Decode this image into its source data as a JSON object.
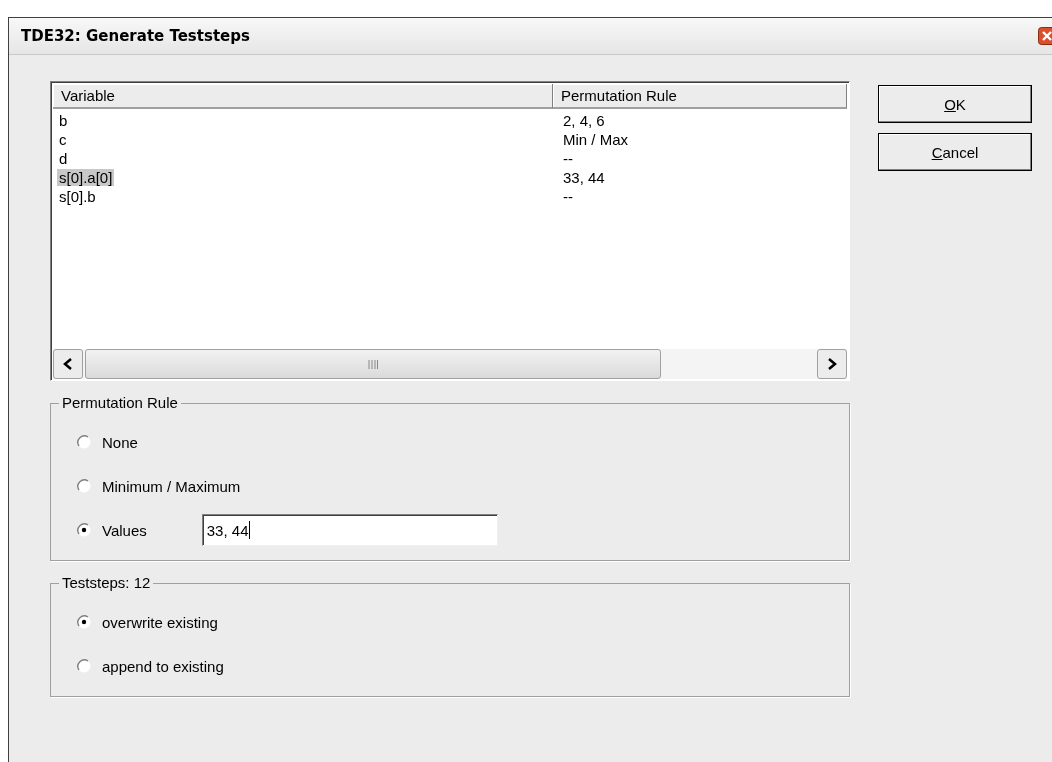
{
  "window": {
    "title": "TDE32: Generate Teststeps"
  },
  "table": {
    "columns": [
      "Variable",
      "Permutation Rule"
    ],
    "rows": [
      {
        "cells": [
          "b",
          "2, 4, 6"
        ],
        "selected": false
      },
      {
        "cells": [
          "c",
          "Min / Max"
        ],
        "selected": false
      },
      {
        "cells": [
          "d",
          "--"
        ],
        "selected": false
      },
      {
        "cells": [
          "s[0].a[0]",
          "33, 44"
        ],
        "selected": true
      },
      {
        "cells": [
          "s[0].b",
          "--"
        ],
        "selected": false
      }
    ]
  },
  "buttons": [
    {
      "access_key": "O",
      "label_rest": "K"
    },
    {
      "access_key": "C",
      "label_rest": "ancel"
    }
  ],
  "permutation_rule": {
    "title": "Permutation Rule",
    "options": [
      {
        "label": "None",
        "selected": false
      },
      {
        "label": "Minimum / Maximum",
        "selected": false
      },
      {
        "label": "Values",
        "selected": true
      }
    ],
    "values_field": {
      "value": "33, 44"
    }
  },
  "teststeps": {
    "title": "Teststeps: 12",
    "options": [
      {
        "label": "overwrite existing",
        "selected": true
      },
      {
        "label": "append to existing",
        "selected": false
      }
    ]
  }
}
